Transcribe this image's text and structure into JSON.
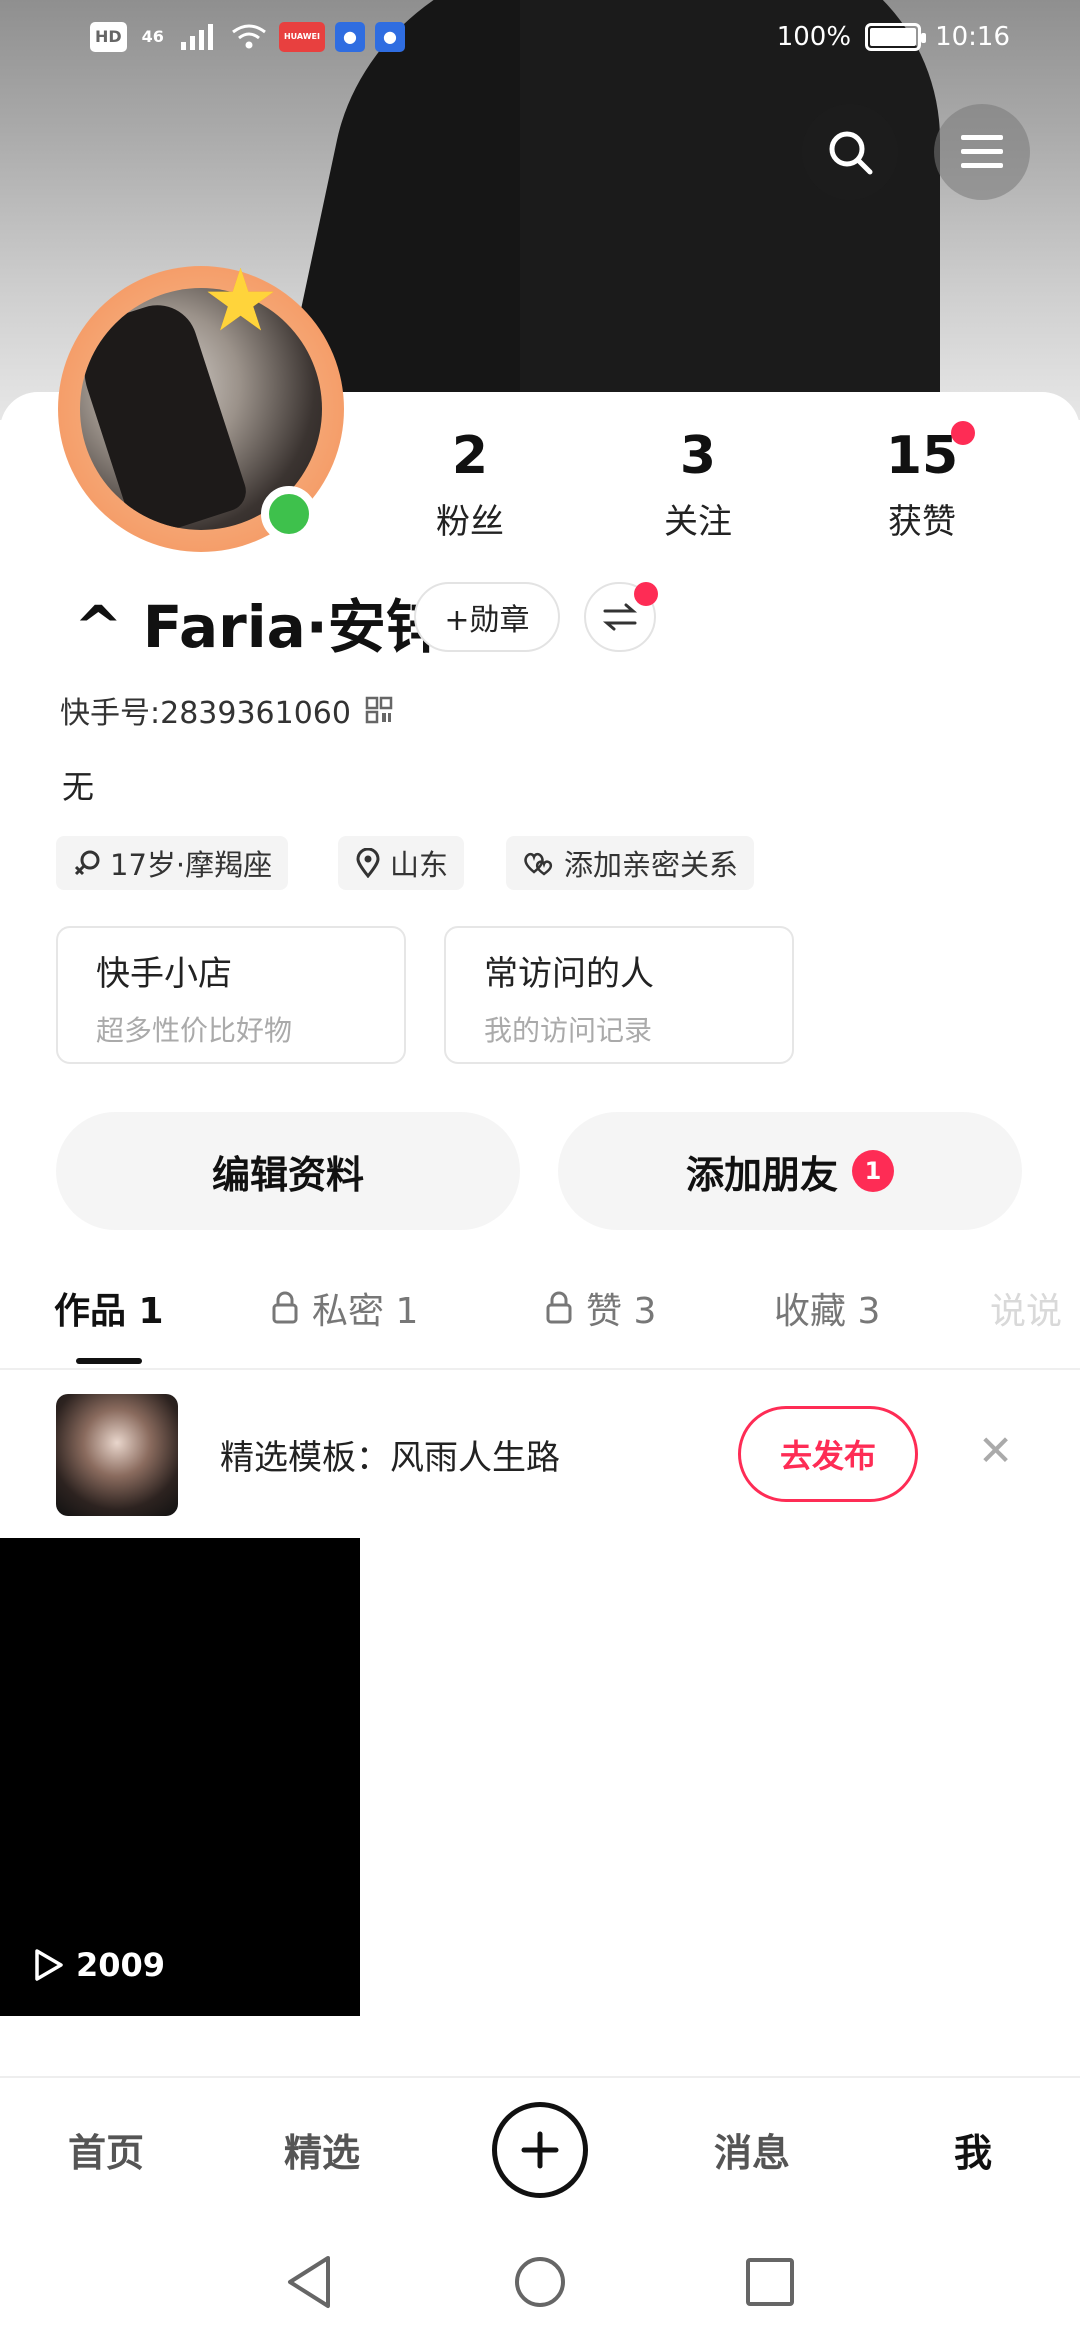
{
  "status_bar": {
    "left_badges": [
      "HD",
      "46",
      "HUAWEI"
    ],
    "battery": "100%",
    "time": "10:16"
  },
  "header": {
    "search_icon": "search-icon",
    "menu_icon": "hamburger-menu-icon"
  },
  "profile": {
    "stats": [
      {
        "value": "2",
        "label": "粉丝"
      },
      {
        "value": "3",
        "label": "关注"
      },
      {
        "value": "15",
        "label": "获赞"
      }
    ],
    "name": "^ Faria·安锌",
    "medal_label": "+勋章",
    "kuaishou_id": "快手号:2839361060",
    "bio": "无",
    "tags": [
      {
        "icon": "gender-icon",
        "text": "17岁·摩羯座"
      },
      {
        "icon": "location-pin-icon",
        "text": "山东"
      },
      {
        "icon": "hearts-icon",
        "text": "添加亲密关系"
      }
    ],
    "entries": [
      {
        "title": "快手小店",
        "subtitle": "超多性价比好物"
      },
      {
        "title": "常访问的人",
        "subtitle": "我的访问记录"
      }
    ],
    "edit_profile": "编辑资料",
    "add_friends": "添加朋友",
    "add_friends_badge": "1"
  },
  "tabs": [
    {
      "label": "作品 1"
    },
    {
      "label": "私密 1"
    },
    {
      "label": "赞 3"
    },
    {
      "label": "收藏 3"
    },
    {
      "label": "说说"
    }
  ],
  "template_banner": {
    "text": "精选模板：风雨人生路",
    "button": "去发布"
  },
  "video": {
    "plays": "2009"
  },
  "bottom_nav": {
    "items": [
      "首页",
      "精选",
      "消息",
      "我"
    ]
  }
}
